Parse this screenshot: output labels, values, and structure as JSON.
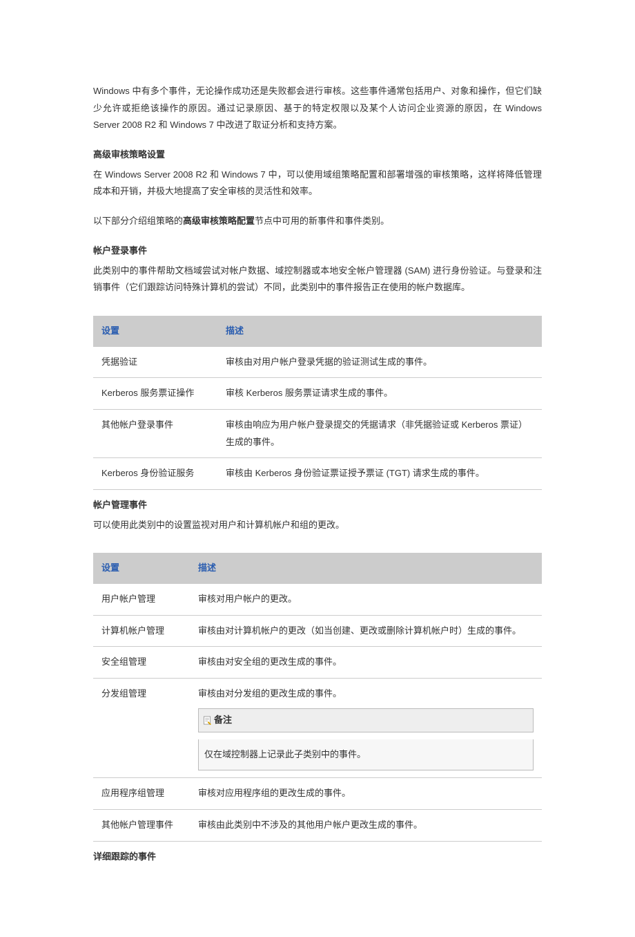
{
  "intro": {
    "p1": "Windows 中有多个事件，无论操作成功还是失败都会进行审核。这些事件通常包括用户、对象和操作，但它们缺少允许或拒绝该操作的原因。通过记录原因、基于的特定权限以及某个人访问企业资源的原因，在 Windows Server 2008 R2 和 Windows 7 中改进了取证分析和支持方案。"
  },
  "section1": {
    "heading": "高级审核策略设置",
    "p1": "在 Windows Server 2008 R2 和 Windows 7 中，可以使用域组策略配置和部署增强的审核策略，这样将降低管理成本和开销，并极大地提高了安全审核的灵活性和效率。",
    "p2_pre": "以下部分介绍组策略的",
    "p2_bold": "高级审核策略配置",
    "p2_post": "节点中可用的新事件和事件类别。"
  },
  "section2": {
    "heading": "帐户登录事件",
    "p1": "此类别中的事件帮助文档域尝试对帐户数据、域控制器或本地安全帐户管理器 (SAM) 进行身份验证。与登录和注销事件（它们跟踪访问特殊计算机的尝试）不同，此类别中的事件报告正在使用的帐户数据库。"
  },
  "table1": {
    "headers": {
      "c1": "设置",
      "c2": "描述"
    },
    "rows": [
      {
        "c1": "凭据验证",
        "c2": "审核由对用户帐户登录凭据的验证测试生成的事件。"
      },
      {
        "c1": "Kerberos 服务票证操作",
        "c2": "审核 Kerberos 服务票证请求生成的事件。"
      },
      {
        "c1": "其他帐户登录事件",
        "c2": "审核由响应为用户帐户登录提交的凭据请求（非凭据验证或 Kerberos 票证）生成的事件。"
      },
      {
        "c1": "Kerberos 身份验证服务",
        "c2": "审核由 Kerberos 身份验证票证授予票证 (TGT) 请求生成的事件。"
      }
    ]
  },
  "section3": {
    "heading": "帐户管理事件",
    "p1": "可以使用此类别中的设置监视对用户和计算机帐户和组的更改。"
  },
  "table2": {
    "headers": {
      "c1": "设置",
      "c2": "描述"
    },
    "rows": [
      {
        "c1": "用户帐户管理",
        "c2": "审核对用户帐户的更改。"
      },
      {
        "c1": "计算机帐户管理",
        "c2": "审核由对计算机帐户的更改（如当创建、更改或删除计算机帐户时）生成的事件。"
      },
      {
        "c1": "安全组管理",
        "c2": "审核由对安全组的更改生成的事件。"
      },
      {
        "c1": "分发组管理",
        "c2": "审核由对分发组的更改生成的事件。",
        "note_label": "备注",
        "note_body": "仅在域控制器上记录此子类别中的事件。"
      },
      {
        "c1": "应用程序组管理",
        "c2": "审核对应用程序组的更改生成的事件。"
      },
      {
        "c1": "其他帐户管理事件",
        "c2": "审核由此类别中不涉及的其他用户帐户更改生成的事件。"
      }
    ]
  },
  "section4": {
    "heading": "详细跟踪的事件"
  }
}
